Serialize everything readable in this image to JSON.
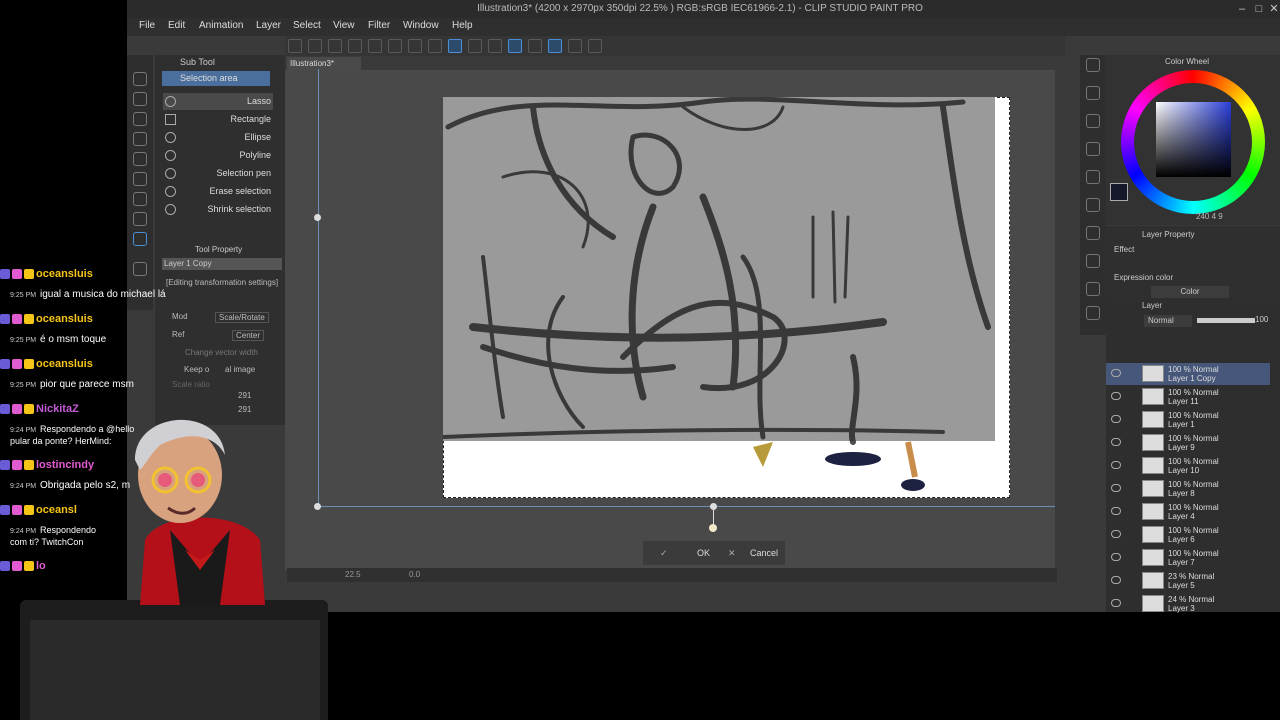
{
  "window": {
    "title": "Illustration3* (4200 x 2970px 350dpi 22.5% ) RGB:sRGB IEC61966-2.1) - CLIP STUDIO PAINT PRO",
    "min": "–",
    "max": "□",
    "close": "✕"
  },
  "menu": [
    "File",
    "Edit",
    "Animation",
    "Layer",
    "Select",
    "View",
    "Filter",
    "Window",
    "Help"
  ],
  "subtool": {
    "header": "Sub Tool",
    "group": "Selection area",
    "items": [
      {
        "label": "Lasso",
        "active": true
      },
      {
        "label": "Rectangle"
      },
      {
        "label": "Ellipse"
      },
      {
        "label": "Polyline"
      },
      {
        "label": "Selection pen"
      },
      {
        "label": "Erase selection"
      },
      {
        "label": "Shrink selection"
      }
    ]
  },
  "tool_property": {
    "header": "Tool Property",
    "layer": "Layer 1 Copy",
    "editing": "[Editing transformation settings]",
    "mode_label": "Mod",
    "mode_value": "Scale/Rotate",
    "ref_label": "Ref",
    "ref_value": "Center",
    "change_vector": "Change vector width",
    "keep_label": "Keep o",
    "keep_suffix": "al image",
    "scale_label": "Scale ratio",
    "scale_w": "291",
    "scale_h": "291"
  },
  "document": {
    "tab": "Illustration3*"
  },
  "transform": {
    "ok": "OK",
    "cancel": "Cancel"
  },
  "navigator": {
    "zoom": "22.5",
    "angle": "0.0"
  },
  "color_panel": {
    "title": "Color Wheel",
    "h": "240",
    "s": "4",
    "v": "9",
    "main_color": "#14182a"
  },
  "layer_property": {
    "title": "Layer Property",
    "effect": "Effect",
    "expression_label": "Expression color",
    "expression_value": "Color"
  },
  "layer_panel": {
    "title": "Layer",
    "blend": "Normal",
    "opacity": "100",
    "layers": [
      {
        "mode": "100 % Normal",
        "name": "Layer 1 Copy",
        "selected": true
      },
      {
        "mode": "100 % Normal",
        "name": "Layer 11"
      },
      {
        "mode": "100 % Normal",
        "name": "Layer 1"
      },
      {
        "mode": "100 % Normal",
        "name": "Layer 9"
      },
      {
        "mode": "100 % Normal",
        "name": "Layer 10"
      },
      {
        "mode": "100 % Normal",
        "name": "Layer 8"
      },
      {
        "mode": "100 % Normal",
        "name": "Layer 4"
      },
      {
        "mode": "100 % Normal",
        "name": "Layer 6"
      },
      {
        "mode": "100 % Normal",
        "name": "Layer 7"
      },
      {
        "mode": "23 % Normal",
        "name": "Layer 5"
      },
      {
        "mode": "24 % Normal",
        "name": "Layer 3"
      }
    ]
  },
  "chat": [
    {
      "user": "oceansluis",
      "color": "#f5c518",
      "time": "9:25 PM",
      "text": "igual a musica do michael lá"
    },
    {
      "user": "oceansluis",
      "color": "#f5c518",
      "time": "9:25 PM",
      "text": "é o msm toque"
    },
    {
      "user": "oceansluis",
      "color": "#f5c518",
      "time": "9:25 PM",
      "text": "pior que parece msm"
    },
    {
      "user": "NickitaZ",
      "color": "#c45bd6",
      "time": "9:24 PM",
      "text": "Respondendo a @hello",
      "text2": "pular da ponte? HerMind:"
    },
    {
      "user": "lostincindy",
      "color": "#e05ad0",
      "time": "9:24 PM",
      "text": "Obrigada pelo s2, m"
    },
    {
      "user": "oceansl",
      "color": "#f5c518",
      "time": "9:24 PM",
      "text": "Respondendo",
      "text2": "com ti? TwitchCon"
    },
    {
      "user": "lo",
      "color": "#e05ad0",
      "time": "9:24 PM",
      "text": ""
    }
  ]
}
